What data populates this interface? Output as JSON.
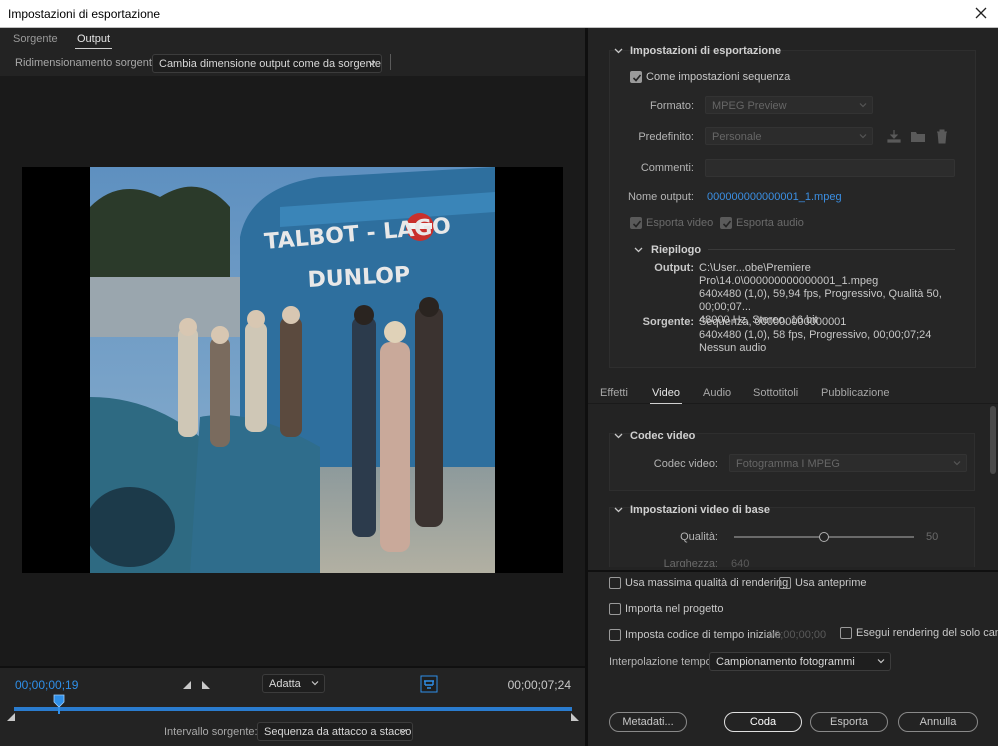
{
  "window": {
    "title": "Impostazioni di esportazione"
  },
  "left": {
    "tabs": [
      {
        "label": "Sorgente"
      },
      {
        "label": "Output"
      }
    ],
    "resize_label": "Ridimensionamento sorgente:",
    "resize_value": "Cambia dimensione output come da sorgente",
    "current_tc": "00;00;00;19",
    "duration_tc": "00;00;07;24",
    "fit_value": "Adatta",
    "range_label": "Intervallo sorgente:",
    "range_value": "Sequenza da attacco a stacco",
    "video_text": {
      "line1": "TALBOT - LAGO",
      "line2": "DUNLOP"
    }
  },
  "export": {
    "section_title": "Impostazioni di esportazione",
    "match_sequence": "Come impostazioni sequenza",
    "format_label": "Formato:",
    "format_value": "MPEG Preview",
    "preset_label": "Predefinito:",
    "preset_value": "Personale",
    "comments_label": "Commenti:",
    "output_name_label": "Nome output:",
    "output_name_value": "000000000000001_1.mpeg",
    "export_video": "Esporta video",
    "export_audio": "Esporta audio",
    "summary_title": "Riepilogo",
    "output_label": "Output:",
    "output_lines": [
      "C:\\User...obe\\Premiere Pro\\14.0\\000000000000001_1.mpeg",
      "640x480 (1,0), 59,94 fps, Progressivo, Qualità 50, 00;00;07...",
      "48000 Hz, Stereo, 16 bit"
    ],
    "source_label": "Sorgente:",
    "source_lines": [
      "Sequenza, 000000000000001",
      "640x480 (1,0), 58 fps, Progressivo, 00;00;07;24",
      "Nessun audio"
    ]
  },
  "right_tabs": [
    {
      "label": "Effetti"
    },
    {
      "label": "Video"
    },
    {
      "label": "Audio"
    },
    {
      "label": "Sottotitoli"
    },
    {
      "label": "Pubblicazione"
    }
  ],
  "video": {
    "codec_section": "Codec video",
    "codec_label": "Codec video:",
    "codec_value": "Fotogramma I MPEG",
    "basic_section": "Impostazioni video di base",
    "quality_label": "Qualità:",
    "quality_value": "50",
    "quality_fraction": 0.5,
    "width_label": "Larghezza:",
    "width_value": "640"
  },
  "options": {
    "max_quality": "Usa massima qualità di rendering",
    "use_previews": "Usa anteprime",
    "import_project": "Importa nel progetto",
    "set_start_tc": "Imposta codice di tempo iniziale",
    "start_tc_value": "00;00;00;00",
    "render_alpha": "Esegui rendering del solo canale a",
    "interp_label": "Interpolazione tempo:",
    "interp_value": "Campionamento fotogrammi"
  },
  "buttons": {
    "metadata": "Metadati...",
    "queue": "Coda",
    "export": "Esporta",
    "cancel": "Annulla"
  },
  "colors": {
    "accent": "#2f8fe8",
    "link": "#3b8fe3",
    "panel": "#232323"
  }
}
